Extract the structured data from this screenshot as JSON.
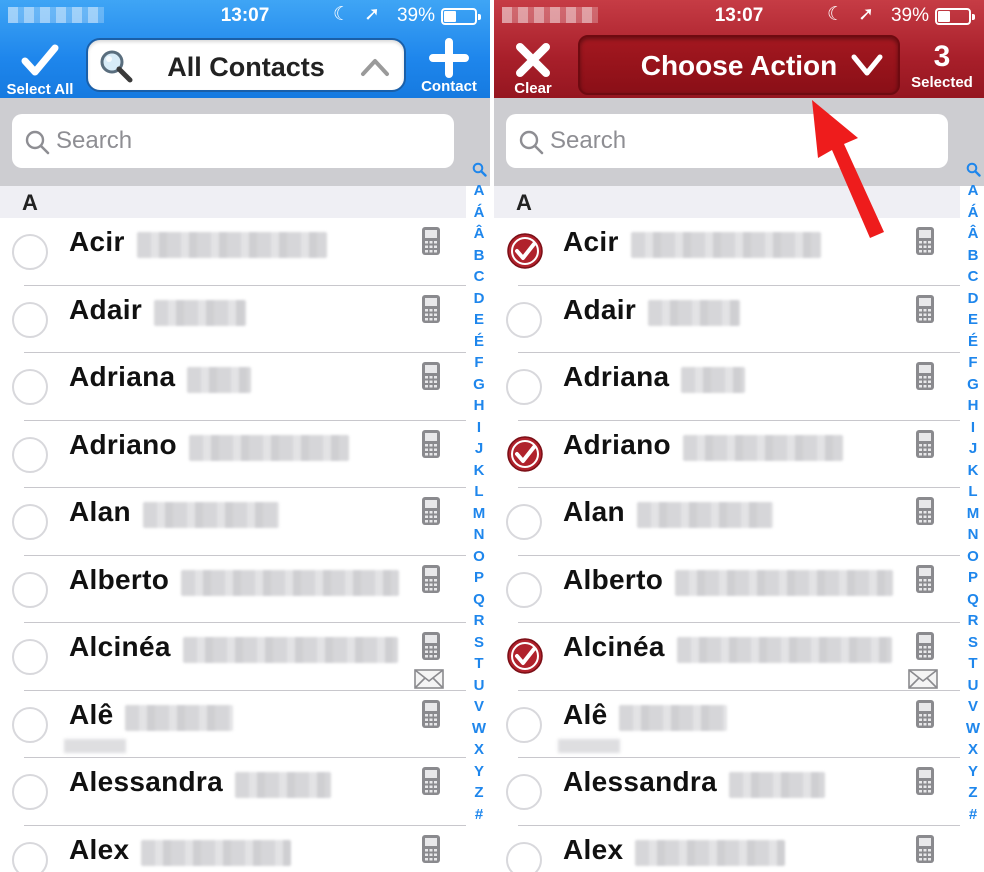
{
  "status": {
    "time": "13:07",
    "battery_pct": "39%"
  },
  "left": {
    "select_all_label": "Select All",
    "picker_label": "All Contacts",
    "add_label": "Contact",
    "search_placeholder": "Search",
    "section": "A"
  },
  "right": {
    "clear_label": "Clear",
    "action_label": "Choose Action",
    "selected_count": "3",
    "selected_label": "Selected",
    "search_placeholder": "Search",
    "section": "A"
  },
  "contacts": [
    {
      "name": "Acir",
      "selected_right": true,
      "blur_width": 190,
      "email": false,
      "second_line": false
    },
    {
      "name": "Adair",
      "selected_right": false,
      "blur_width": 92,
      "email": false,
      "second_line": false
    },
    {
      "name": "Adriana",
      "selected_right": false,
      "blur_width": 64,
      "email": false,
      "second_line": false
    },
    {
      "name": "Adriano",
      "selected_right": true,
      "blur_width": 160,
      "email": false,
      "second_line": false
    },
    {
      "name": "Alan",
      "selected_right": false,
      "blur_width": 136,
      "email": false,
      "second_line": false
    },
    {
      "name": "Alberto",
      "selected_right": false,
      "blur_width": 218,
      "email": false,
      "second_line": false
    },
    {
      "name": "Alcinéa",
      "selected_right": true,
      "blur_width": 215,
      "email": true,
      "second_line": false
    },
    {
      "name": "Alê",
      "selected_right": false,
      "blur_width": 108,
      "email": false,
      "second_line": true
    },
    {
      "name": "Alessandra",
      "selected_right": false,
      "blur_width": 96,
      "email": false,
      "second_line": false
    },
    {
      "name": "Alex",
      "selected_right": false,
      "blur_width": 150,
      "email": false,
      "second_line": false
    }
  ],
  "index_letters": [
    "A",
    "Á",
    "Â",
    "B",
    "C",
    "D",
    "E",
    "É",
    "F",
    "G",
    "H",
    "I",
    "J",
    "K",
    "L",
    "M",
    "N",
    "O",
    "P",
    "Q",
    "R",
    "S",
    "T",
    "U",
    "V",
    "W",
    "X",
    "Y",
    "Z",
    "#"
  ],
  "colors": {
    "left_bar": "#1e86ec",
    "right_bar": "#a81f2a",
    "index_text": "#1e86ec",
    "check": "#b0222c",
    "annotation_arrow": "#ee1c1c"
  }
}
